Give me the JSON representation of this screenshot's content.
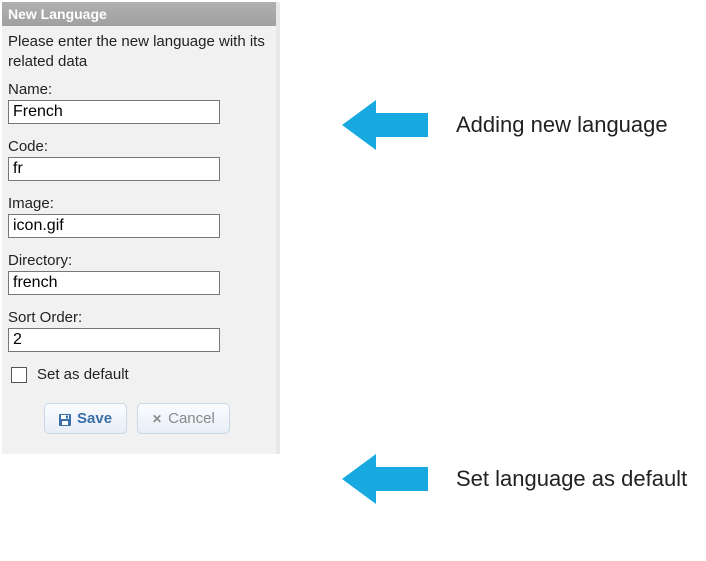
{
  "panel": {
    "title": "New Language",
    "instruction": "Please enter the new language with its related data"
  },
  "fields": {
    "name": {
      "label": "Name:",
      "value": "French"
    },
    "code": {
      "label": "Code:",
      "value": "fr"
    },
    "image": {
      "label": "Image:",
      "value": "icon.gif"
    },
    "directory": {
      "label": "Directory:",
      "value": "french"
    },
    "sortOrder": {
      "label": "Sort Order:",
      "value": "2"
    }
  },
  "checkbox": {
    "label": "Set as default"
  },
  "buttons": {
    "save": "Save",
    "cancel": "Cancel"
  },
  "annotations": {
    "arrowColor": "#17a9e0",
    "addLanguage": "Adding new language",
    "setDefault": "Set language as default"
  }
}
